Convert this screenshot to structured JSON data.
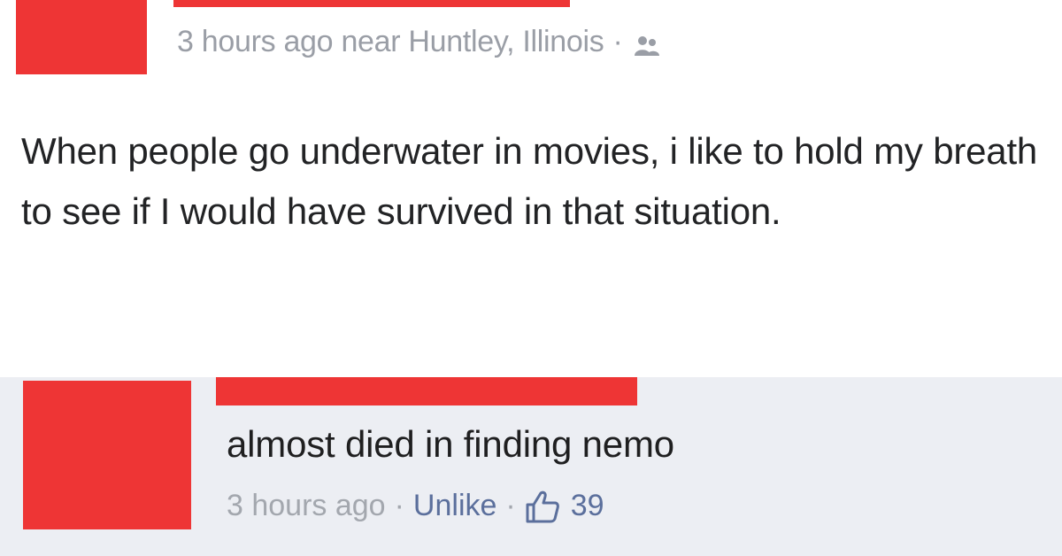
{
  "post": {
    "timestamp": "3 hours ago",
    "location": "near Huntley, Illinois",
    "separator": "·",
    "audience_icon": "friends-icon",
    "text": "When people go underwater in movies, i like to hold my breath to see if I would have survived in that situation."
  },
  "comment": {
    "text": "almost died in finding nemo",
    "timestamp": "3 hours ago",
    "separator": "·",
    "unlike_label": "Unlike",
    "like_icon": "thumbs-up-icon",
    "like_count": "39"
  },
  "colors": {
    "redaction": "#ee3535",
    "meta_text": "#9a9ea6",
    "link": "#5b6f9c",
    "comment_bg": "#eceef3"
  }
}
